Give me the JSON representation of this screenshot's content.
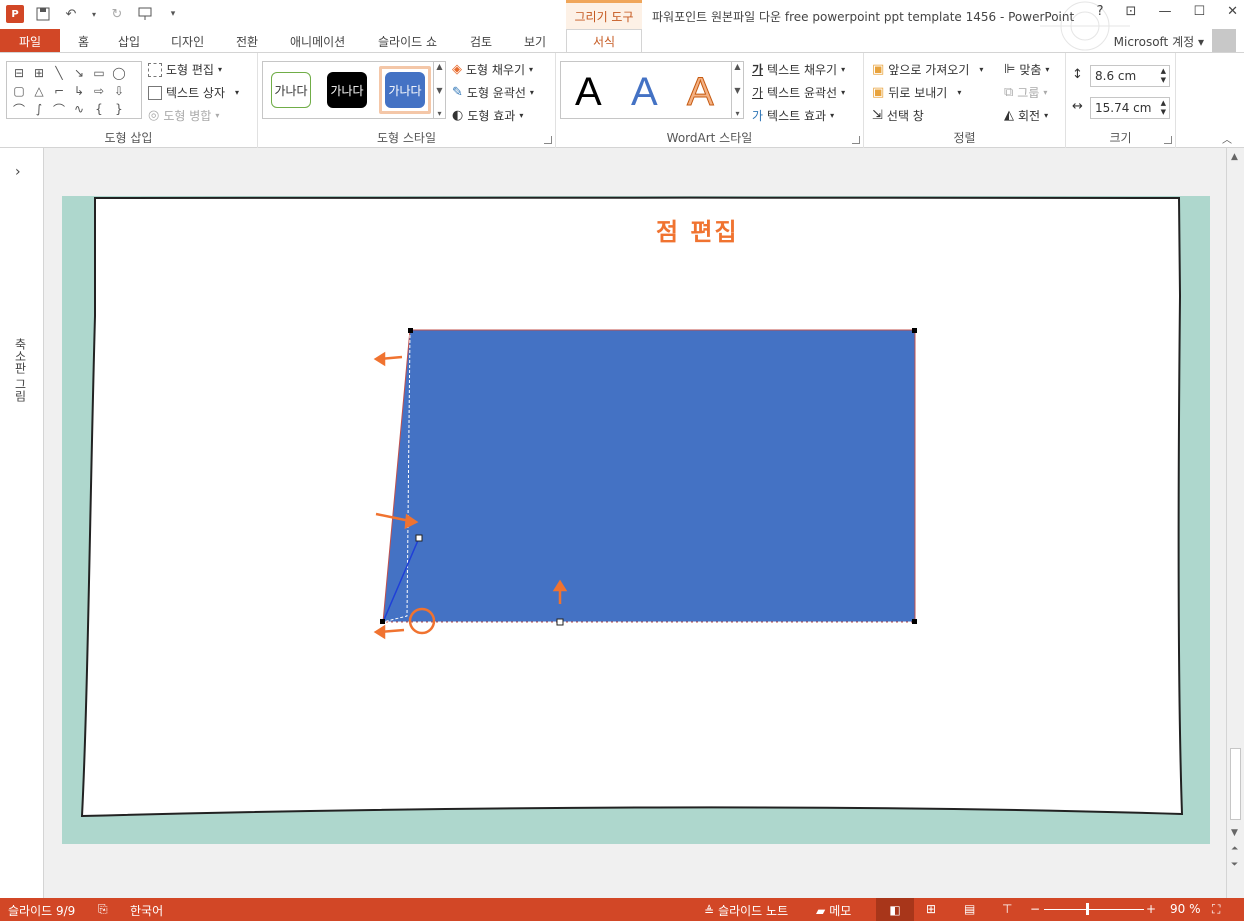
{
  "titlebar": {
    "app_icon": "P",
    "context_title": "그리기 도구",
    "doc_title": "파워포인트 원본파일 다운 free powerpoint ppt template 1456 - PowerPoint",
    "help": "?",
    "restore_ribbon": "⊡",
    "minimize": "—",
    "maximize": "☐",
    "close": "✕"
  },
  "tabs": {
    "file": "파일",
    "items": [
      "홈",
      "삽입",
      "디자인",
      "전환",
      "애니메이션",
      "슬라이드 쇼",
      "검토",
      "보기"
    ],
    "active": "서식",
    "account": "Microsoft 계정"
  },
  "ribbon": {
    "insert_shapes": {
      "label": "도형 삽입",
      "edit_shape": "도형 편집",
      "text_box": "텍스트 상자",
      "merge_shapes": "도형 병합"
    },
    "shape_styles": {
      "label": "도형 스타일",
      "swatch_text": "가나다",
      "fill": "도형 채우기",
      "outline": "도형 윤곽선",
      "effects": "도형 효과"
    },
    "wordart_styles": {
      "label": "WordArt 스타일",
      "letter": "A",
      "text_fill": "텍스트 채우기",
      "text_outline": "텍스트 윤곽선",
      "text_effects": "텍스트 효과"
    },
    "arrange": {
      "label": "정렬",
      "bring_forward": "앞으로 가져오기",
      "send_backward": "뒤로 보내기",
      "selection_pane": "선택 창",
      "align": "맞춤",
      "group": "그룹",
      "rotate": "회전"
    },
    "size": {
      "label": "크기",
      "height": "8.6 cm",
      "width": "15.74 cm"
    }
  },
  "leftpane": {
    "expand": "›",
    "label": "축소판 그림"
  },
  "slide": {
    "title": "점 편집",
    "shape_fill": "#4472c4",
    "accent": "#f07330"
  },
  "statusbar": {
    "slide_info": "슬라이드 9/9",
    "language": "한국어",
    "notes": "슬라이드 노트",
    "comments": "메모",
    "zoom": "90 %",
    "zoom_level": 0.9
  }
}
